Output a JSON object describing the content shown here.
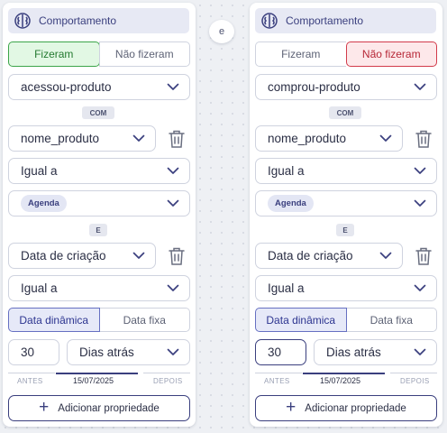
{
  "connector_label": "e",
  "colors": {
    "primary": "#3a3f7e",
    "selected_green": "#3ca54a",
    "selected_red": "#d23b4b",
    "border": "#cfd3df"
  },
  "cards": [
    {
      "header": "Comportamento",
      "header_icon": "brain-icon",
      "toggle": {
        "option_a": "Fizeram",
        "option_b": "Não fizeram",
        "selected": "option_a"
      },
      "event_select": "acessou-produto",
      "with_label": "COM",
      "property_select": "nome_produto",
      "operator_select": "Igual a",
      "value_chip": "Agenda",
      "and_label": "E",
      "property2_select": "Data de criação",
      "operator2_select": "Igual a",
      "date_mode": {
        "option_a": "Data dinâmica",
        "option_b": "Data fixa",
        "selected": "option_a"
      },
      "amount": "30",
      "unit_select": "Dias atrás",
      "range": {
        "before": "ANTES",
        "date": "15/07/2025",
        "after": "DEPOIS"
      },
      "add_button": "Adicionar propriedade"
    },
    {
      "header": "Comportamento",
      "header_icon": "brain-icon",
      "toggle": {
        "option_a": "Fizeram",
        "option_b": "Não fizeram",
        "selected": "option_b"
      },
      "event_select": "comprou-produto",
      "with_label": "COM",
      "property_select": "nome_produto",
      "operator_select": "Igual a",
      "value_chip": "Agenda",
      "and_label": "E",
      "property2_select": "Data de criação",
      "operator2_select": "Igual a",
      "date_mode": {
        "option_a": "Data dinâmica",
        "option_b": "Data fixa",
        "selected": "option_a"
      },
      "amount": "30",
      "unit_select": "Dias atrás",
      "range": {
        "before": "ANTES",
        "date": "15/07/2025",
        "after": "DEPOIS"
      },
      "add_button": "Adicionar propriedade"
    }
  ]
}
